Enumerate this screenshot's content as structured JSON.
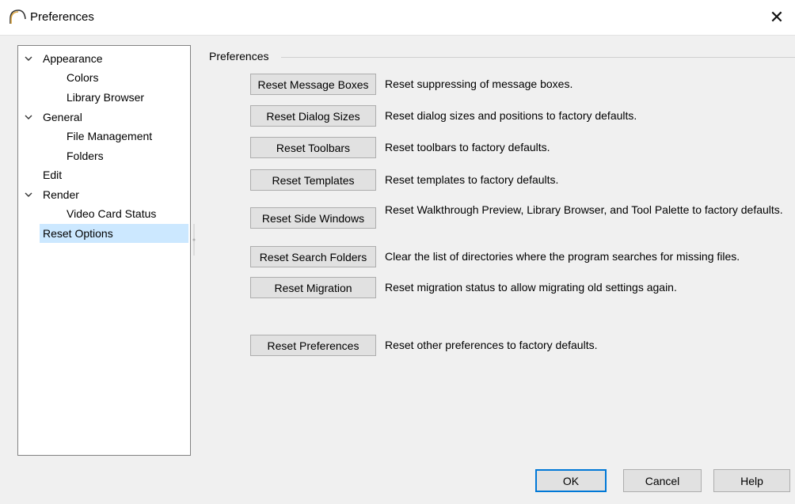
{
  "window": {
    "title": "Preferences",
    "close_glyph": "✕"
  },
  "tree": {
    "items": [
      {
        "label": "Appearance",
        "expanded": true
      },
      {
        "label": "Colors"
      },
      {
        "label": "Library Browser"
      },
      {
        "label": "General",
        "expanded": true
      },
      {
        "label": "File Management"
      },
      {
        "label": "Folders"
      },
      {
        "label": "Edit"
      },
      {
        "label": "Render",
        "expanded": true
      },
      {
        "label": "Video Card Status"
      },
      {
        "label": "Reset Options",
        "selected": true
      }
    ]
  },
  "panel": {
    "group_label": "Preferences",
    "rows": [
      {
        "button": "Reset Message Boxes",
        "description": "Reset suppressing of message boxes."
      },
      {
        "button": "Reset Dialog Sizes",
        "description": "Reset dialog sizes and positions to factory defaults."
      },
      {
        "button": "Reset Toolbars",
        "description": "Reset toolbars to factory defaults."
      },
      {
        "button": "Reset Templates",
        "description": "Reset templates to factory defaults."
      },
      {
        "button": "Reset Side Windows",
        "description": "Reset Walkthrough Preview, Library Browser, and Tool Palette to factory defaults."
      },
      {
        "button": "Reset Search Folders",
        "description": "Clear the list of directories where the program searches for missing files."
      },
      {
        "button": "Reset Migration",
        "description": "Reset migration status to allow migrating old settings again."
      },
      {
        "button": "Reset Preferences",
        "description": "Reset other preferences to factory defaults."
      }
    ]
  },
  "footer": {
    "ok": "OK",
    "cancel": "Cancel",
    "help": "Help"
  },
  "colors": {
    "selection": "#cce8ff",
    "default_button_border": "#0078d7",
    "app_icon": "#d9a441"
  }
}
